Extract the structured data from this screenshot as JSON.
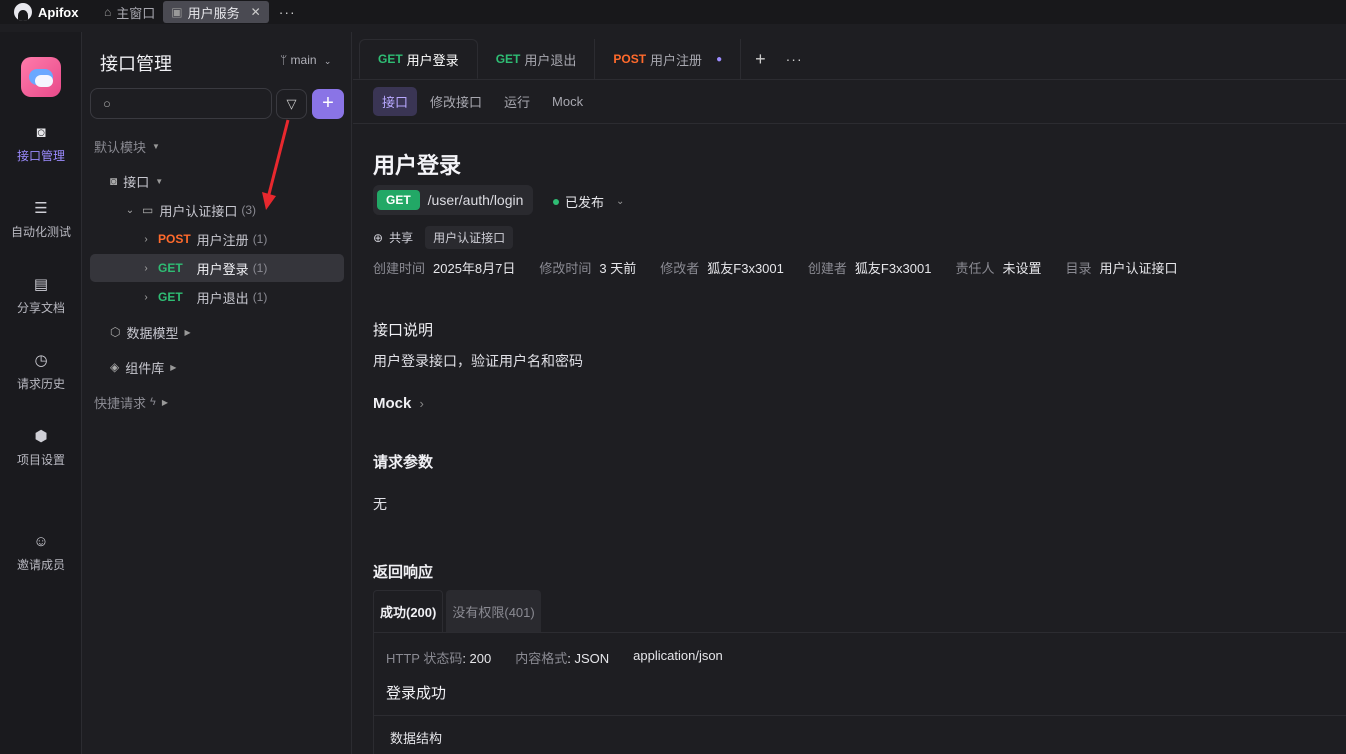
{
  "titlebar": {
    "app_name": "Apifox",
    "tabs": [
      {
        "label": "主窗口"
      },
      {
        "label": "用户服务"
      }
    ]
  },
  "leftnav": {
    "items": [
      {
        "label": "接口管理",
        "icon": "api-icon"
      },
      {
        "label": "自动化测试",
        "icon": "automation-icon"
      },
      {
        "label": "分享文档",
        "icon": "book-icon"
      },
      {
        "label": "请求历史",
        "icon": "clock-icon"
      },
      {
        "label": "项目设置",
        "icon": "settings-icon"
      },
      {
        "label": "邀请成员",
        "icon": "add-user-icon"
      }
    ]
  },
  "sidebar": {
    "title": "接口管理",
    "branch": "main",
    "search_placeholder": "",
    "default_module": "默认模块",
    "api_node": "接口",
    "folder": {
      "name": "用户认证接口",
      "count": "(3)"
    },
    "endpoints": [
      {
        "method": "POST",
        "name": "用户注册",
        "count": "(1)"
      },
      {
        "method": "GET",
        "name": "用户登录",
        "count": "(1)"
      },
      {
        "method": "GET",
        "name": "用户退出",
        "count": "(1)"
      }
    ],
    "data_model": "数据模型",
    "components": "组件库",
    "quick_request": "快捷请求"
  },
  "main": {
    "tabs": [
      {
        "method": "GET",
        "name": "用户登录"
      },
      {
        "method": "GET",
        "name": "用户退出"
      },
      {
        "method": "POST",
        "name": "用户注册"
      }
    ],
    "subtabs": [
      "接口",
      "修改接口",
      "运行",
      "Mock"
    ],
    "title": "用户登录",
    "method": "GET",
    "path": "/user/auth/login",
    "status": "已发布",
    "share": "共享",
    "folder_tag": "用户认证接口",
    "meta": [
      {
        "k": "创建时间",
        "v": "2025年8月7日"
      },
      {
        "k": "修改时间",
        "v": "3 天前"
      },
      {
        "k": "修改者",
        "v": "狐友F3x3001"
      },
      {
        "k": "创建者",
        "v": "狐友F3x3001"
      },
      {
        "k": "责任人",
        "v": "未设置"
      },
      {
        "k": "目录",
        "v": "用户认证接口"
      }
    ],
    "desc_title": "接口说明",
    "desc_text": "用户登录接口，验证用户名和密码",
    "mock_title": "Mock",
    "params_title": "请求参数",
    "params_value": "无",
    "response_title": "返回响应",
    "response_tabs": [
      "成功(200)",
      "没有权限(401)"
    ],
    "response": {
      "status_label": "HTTP 状态码",
      "status_value": ": 200",
      "format_label": "内容格式",
      "format_value": ": JSON",
      "content_type": "application/json",
      "desc": "登录成功",
      "structure": "数据结构"
    }
  },
  "colors": {
    "accent": "#8a74e6",
    "get": "#2fbd74",
    "post": "#ff6a2c"
  }
}
